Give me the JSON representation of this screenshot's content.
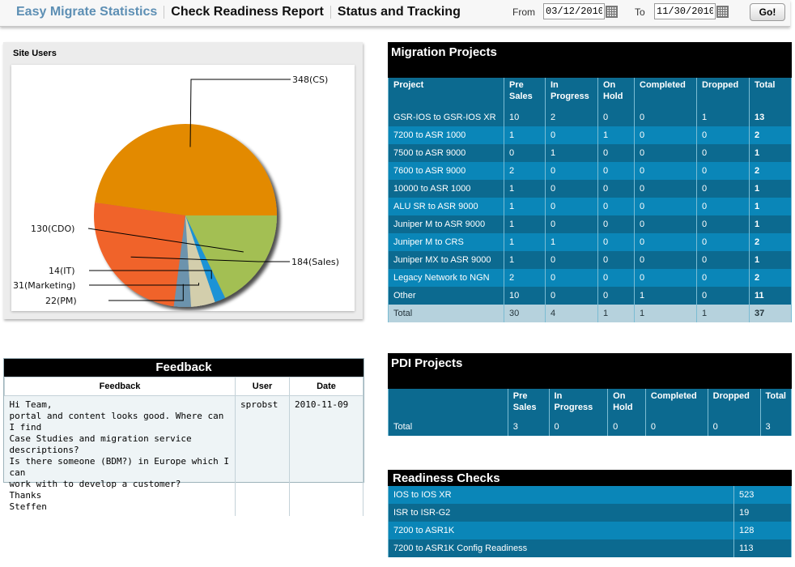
{
  "nav": {
    "items": [
      "Easy Migrate Statistics",
      "Check Readiness Report",
      "Status and Tracking"
    ],
    "from_label": "From",
    "from_value": "03/12/2010",
    "to_label": "To",
    "to_value": "11/30/2010",
    "go_label": "Go!"
  },
  "site_users": {
    "title": "Site Users",
    "labels": [
      "348(CS)",
      "184(Sales)",
      "22(PM)",
      "31(Marketing)",
      "14(IT)",
      "130(CDO)"
    ]
  },
  "chart_data": {
    "type": "pie",
    "title": "Site Users",
    "slices": [
      {
        "label": "CS",
        "value": 348,
        "color": "#e38a00"
      },
      {
        "label": "Sales",
        "value": 184,
        "color": "#f0632a"
      },
      {
        "label": "PM",
        "value": 22,
        "color": "#6c93ad"
      },
      {
        "label": "Marketing",
        "value": 31,
        "color": "#d3ceac"
      },
      {
        "label": "IT",
        "value": 14,
        "color": "#1f93d6"
      },
      {
        "label": "CDO",
        "value": 130,
        "color": "#a3bf52"
      }
    ]
  },
  "feedback": {
    "title": "Feedback",
    "columns": [
      "Feedback",
      "User",
      "Date"
    ],
    "text": "Hi Team,\nportal and content looks good. Where can I find\nCase Studies and migration service descriptions?\nIs there someone (BDM?) in Europe which I can\nwork with to develop a customer?\nThanks\nSteffen",
    "user": "sprobst",
    "date": "2010-11-09"
  },
  "migration": {
    "title": "Migration Projects",
    "columns": [
      "Project",
      "Pre Sales",
      "In Progress",
      "On Hold",
      "Completed",
      "Dropped",
      "Total"
    ],
    "rows": [
      [
        "GSR-IOS to GSR-IOS XR",
        "10",
        "2",
        "0",
        "0",
        "1",
        "13"
      ],
      [
        "7200 to ASR 1000",
        "1",
        "0",
        "1",
        "0",
        "0",
        "2"
      ],
      [
        "7500 to ASR 9000",
        "0",
        "1",
        "0",
        "0",
        "0",
        "1"
      ],
      [
        "7600 to ASR 9000",
        "2",
        "0",
        "0",
        "0",
        "0",
        "2"
      ],
      [
        "10000 to ASR 1000",
        "1",
        "0",
        "0",
        "0",
        "0",
        "1"
      ],
      [
        "ALU SR to ASR 9000",
        "1",
        "0",
        "0",
        "0",
        "0",
        "1"
      ],
      [
        "Juniper M to ASR 9000",
        "1",
        "0",
        "0",
        "0",
        "0",
        "1"
      ],
      [
        "Juniper M to CRS",
        "1",
        "1",
        "0",
        "0",
        "0",
        "2"
      ],
      [
        "Juniper MX to ASR 9000",
        "1",
        "0",
        "0",
        "0",
        "0",
        "1"
      ],
      [
        "Legacy Network to NGN",
        "2",
        "0",
        "0",
        "0",
        "0",
        "2"
      ],
      [
        "Other",
        "10",
        "0",
        "0",
        "1",
        "0",
        "11"
      ]
    ],
    "total": [
      "Total",
      "30",
      "4",
      "1",
      "1",
      "1",
      "37"
    ]
  },
  "pdi": {
    "title": "PDI Projects",
    "columns": [
      "",
      "Pre Sales",
      "In Progress",
      "On Hold",
      "Completed",
      "Dropped",
      "Total"
    ],
    "total": [
      "Total",
      "3",
      "0",
      "0",
      "0",
      "0",
      "3"
    ]
  },
  "readiness": {
    "title": "Readiness Checks",
    "rows": [
      [
        "IOS to IOS XR",
        "523"
      ],
      [
        "ISR to ISR-G2",
        "19"
      ],
      [
        "7200 to ASR1K",
        "128"
      ],
      [
        "7200 to ASR1K Config Readiness",
        "113"
      ]
    ]
  }
}
